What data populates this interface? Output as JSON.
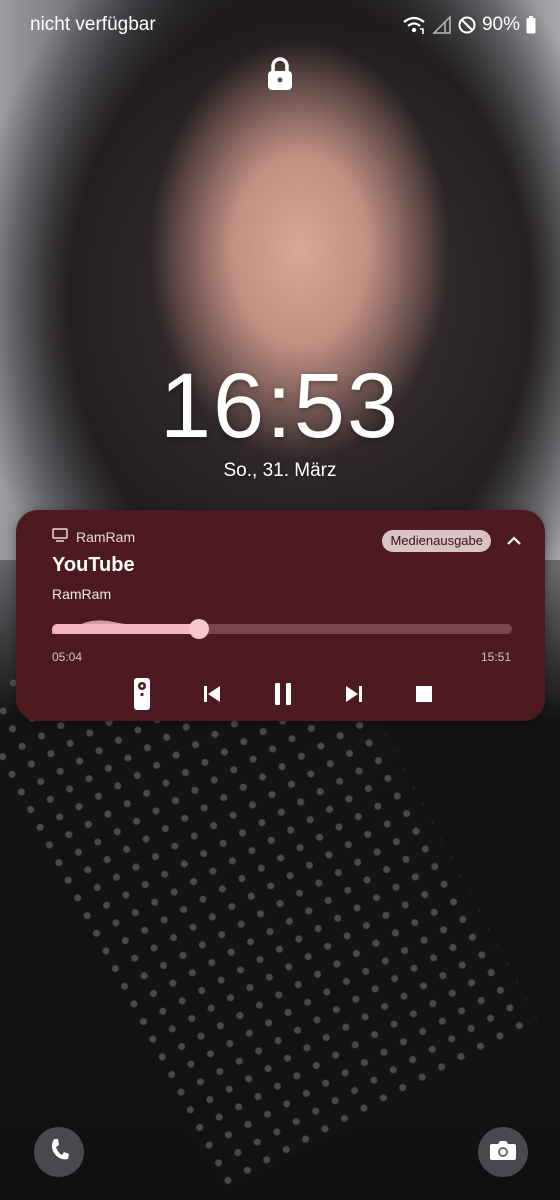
{
  "status_bar": {
    "carrier": "nicht verfügbar",
    "battery_percent": "90%",
    "icons": [
      "wifi-calling-icon",
      "no-signal-icon",
      "do-not-disturb-icon",
      "battery-icon"
    ]
  },
  "lock_screen": {
    "time": "16:53",
    "date": "So., 31. März"
  },
  "media_player": {
    "device_name": "RamRam",
    "output_button": "Medienausgabe",
    "title": "YouTube",
    "artist": "RamRam",
    "elapsed": "05:04",
    "duration": "15:51",
    "progress_fraction": 0.319,
    "state": "playing",
    "controls": [
      "remote-icon",
      "skip-previous-icon",
      "pause-icon",
      "skip-next-icon",
      "stop-icon"
    ],
    "colors": {
      "card_bg": "#4e1a22",
      "accent": "#f2b7c1"
    }
  },
  "shortcuts": {
    "left": "phone-icon",
    "right": "camera-icon"
  }
}
